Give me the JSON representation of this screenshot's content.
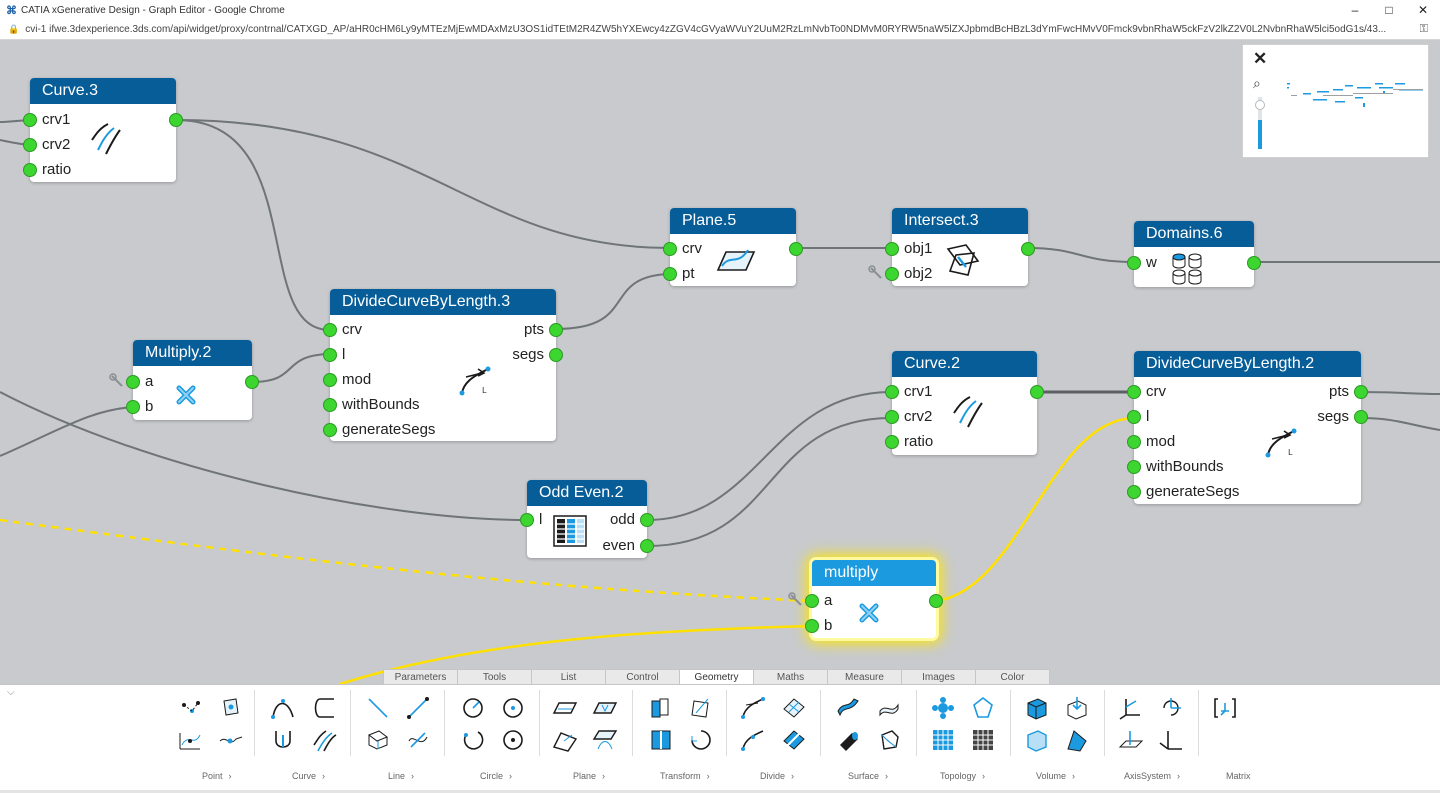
{
  "window": {
    "title": "CATIA xGenerative Design - Graph Editor - Google Chrome",
    "minimize": "–",
    "maximize": "□",
    "close": "✕"
  },
  "url": "cvi-1 ifwe.3dexperience.3ds.com/api/widget/proxy/contrnal/CATXGD_AP/aHR0cHM6Ly9yMTEzMjEwMDAxMzU3OS1idTEtM2R4ZW5hYXEwcy4zZGV4cGVyaWVuY2UuM2RzLmNvbTo0NDMvM0RYRW5naW5lZXJpbmdBcHBzL3dYmFwcHMvV0Fmck9vbnRhaW5ckFzV2lkZ2V0L2NvbnRhaW5lci5odG1s/43...",
  "minimap": {
    "close_label": "✕",
    "zoom_icon": "zoom-icon",
    "zoom_level": 0.55
  },
  "nodes": {
    "curve3": {
      "title": "Curve.3",
      "inputs": [
        "crv1",
        "crv2",
        "ratio"
      ]
    },
    "multiply2": {
      "title": "Multiply.2",
      "inputs": [
        "a",
        "b"
      ]
    },
    "dcbl3": {
      "title": "DivideCurveByLength.3",
      "inputs": [
        "crv",
        "l",
        "mod",
        "withBounds",
        "generateSegs"
      ],
      "outputs": [
        "pts",
        "segs"
      ]
    },
    "plane5": {
      "title": "Plane.5",
      "inputs": [
        "crv",
        "pt"
      ]
    },
    "intersect3": {
      "title": "Intersect.3",
      "inputs": [
        "obj1",
        "obj2"
      ]
    },
    "domains6": {
      "title": "Domains.6",
      "inputs": [
        "w"
      ]
    },
    "curve2": {
      "title": "Curve.2",
      "inputs": [
        "crv1",
        "crv2",
        "ratio"
      ]
    },
    "dcbl2": {
      "title": "DivideCurveByLength.2",
      "inputs": [
        "crv",
        "l",
        "mod",
        "withBounds",
        "generateSegs"
      ],
      "outputs": [
        "pts",
        "segs"
      ]
    },
    "oddeven2": {
      "title": "Odd Even.2",
      "inputs": [
        "l"
      ],
      "outputs": [
        "odd",
        "even"
      ]
    },
    "multiply": {
      "title": "multiply",
      "inputs": [
        "a",
        "b"
      ]
    }
  },
  "tabs": [
    "Parameters",
    "Tools",
    "List",
    "Control",
    "Geometry",
    "Maths",
    "Measure",
    "Images",
    "Color"
  ],
  "active_tab": "Geometry",
  "categories": [
    "Point",
    "Curve",
    "Line",
    "Circle",
    "Plane",
    "Transform",
    "Divide",
    "Surface",
    "Topology",
    "Volume",
    "AxisSystem",
    "Matrix"
  ],
  "chevron": "›",
  "colors": {
    "node_header": "#075d98",
    "selected_header": "#1b9ae0",
    "port": "#3dd630",
    "wire": "#6f7478",
    "wire_selected": "#ffe000",
    "canvas": "#c8cacd"
  }
}
